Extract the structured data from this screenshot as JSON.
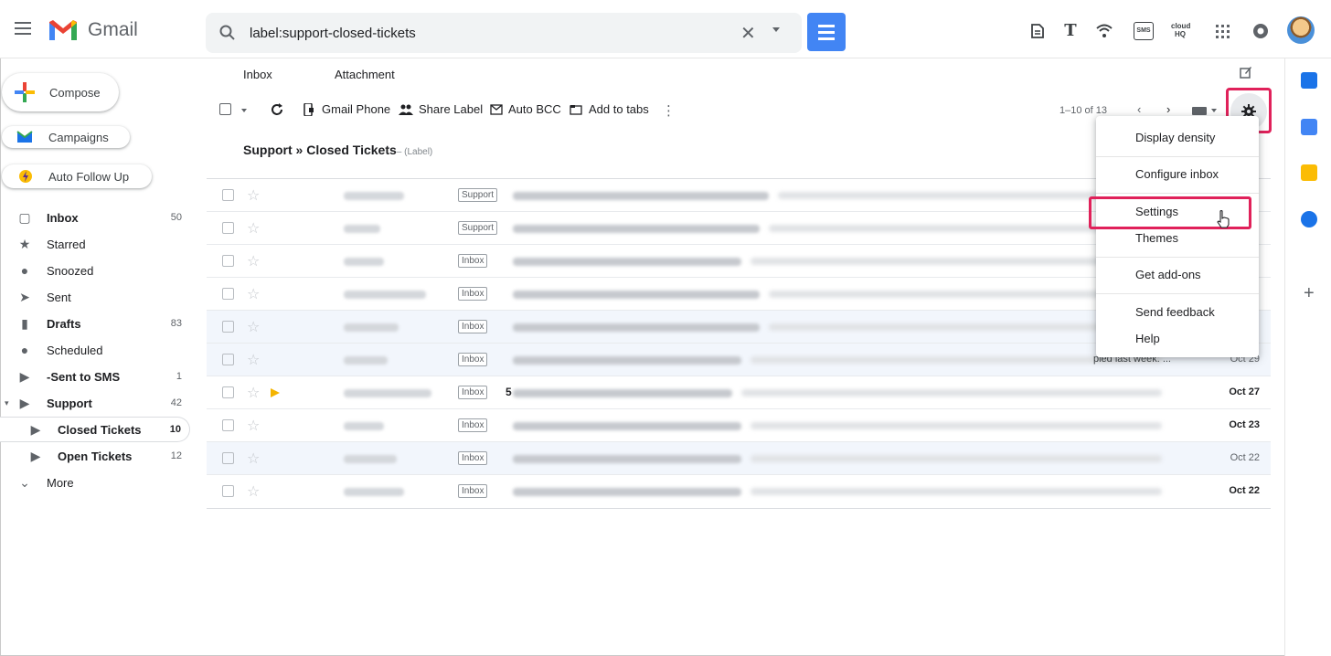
{
  "header": {
    "app_name": "Gmail",
    "search_value": "label:support-closed-tickets",
    "clear_symbol": "✕",
    "icons": [
      "menu-icon",
      "gmail-logo",
      "search-icon",
      "close-icon",
      "chevron-down-icon",
      "filter-icon",
      "document-icon",
      "text-icon",
      "wifi-icon",
      "sms-icon",
      "cloudhq-icon",
      "apps-grid-icon",
      "notifications-icon",
      "avatar"
    ],
    "sms_label": "SMS",
    "cloudhq_label": "cloud HQ"
  },
  "sidebar": {
    "compose_label": "Compose",
    "campaigns_label": "Campaigns",
    "followup_label": "Auto Follow Up",
    "items": [
      {
        "label": "Inbox",
        "count": "50",
        "icon": "inbox-icon",
        "bold": true
      },
      {
        "label": "Starred",
        "count": "",
        "icon": "star-icon",
        "bold": false
      },
      {
        "label": "Snoozed",
        "count": "",
        "icon": "clock-icon",
        "bold": false
      },
      {
        "label": "Sent",
        "count": "",
        "icon": "send-icon",
        "bold": false
      },
      {
        "label": "Drafts",
        "count": "83",
        "icon": "draft-icon",
        "bold": true
      },
      {
        "label": "Scheduled",
        "count": "",
        "icon": "schedule-icon",
        "bold": false
      },
      {
        "label": "-Sent to SMS",
        "count": "1",
        "icon": "label-icon",
        "bold": true
      },
      {
        "label": "Support",
        "count": "42",
        "icon": "label-icon",
        "bold": true
      },
      {
        "label": "Closed Tickets",
        "count": "10",
        "icon": "label-icon",
        "bold": true
      },
      {
        "label": "Open Tickets",
        "count": "12",
        "icon": "label-icon",
        "bold": true
      },
      {
        "label": "More",
        "count": "",
        "icon": "chevron-down-icon",
        "bold": false
      }
    ]
  },
  "main": {
    "tabs": [
      "Inbox",
      "Attachment"
    ],
    "toolbar": {
      "gmail_phone": "Gmail Phone",
      "share_label": "Share Label",
      "auto_bcc": "Auto BCC",
      "add_to_tabs": "Add to tabs"
    },
    "pager": "1–10 of 13",
    "label_title": "Support » Closed Tickets",
    "label_suffix": "– (Label)",
    "rows": [
      {
        "tag": "Support",
        "lead": "",
        "date": "",
        "read": false,
        "extra": ""
      },
      {
        "tag": "Support",
        "lead": "",
        "date": "",
        "read": false,
        "extra": ""
      },
      {
        "tag": "Inbox",
        "lead": "",
        "date": "",
        "read": false,
        "extra": ""
      },
      {
        "tag": "Inbox",
        "lead": "",
        "date": "",
        "read": false,
        "extra": ""
      },
      {
        "tag": "Inbox",
        "lead": "",
        "date": "",
        "read": true,
        "extra": ""
      },
      {
        "tag": "Inbox",
        "lead": "",
        "date": "Oct 29",
        "read": true,
        "extra": "pied last week: ..."
      },
      {
        "tag": "Inbox",
        "lead": "5",
        "date": "Oct 27",
        "read": false,
        "extra": ""
      },
      {
        "tag": "Inbox",
        "lead": "",
        "date": "Oct 23",
        "read": false,
        "extra": ""
      },
      {
        "tag": "Inbox",
        "lead": "",
        "date": "Oct 22",
        "read": true,
        "extra": ""
      },
      {
        "tag": "Inbox",
        "lead": "",
        "date": "Oct 22",
        "read": false,
        "extra": ""
      }
    ]
  },
  "settings_menu": {
    "items": [
      "Display density",
      "Configure inbox",
      "Settings",
      "Themes",
      "Get add-ons",
      "Send feedback",
      "Help"
    ]
  },
  "colors": {
    "highlight": "#e0215a",
    "accent_blue": "#4285f4"
  }
}
